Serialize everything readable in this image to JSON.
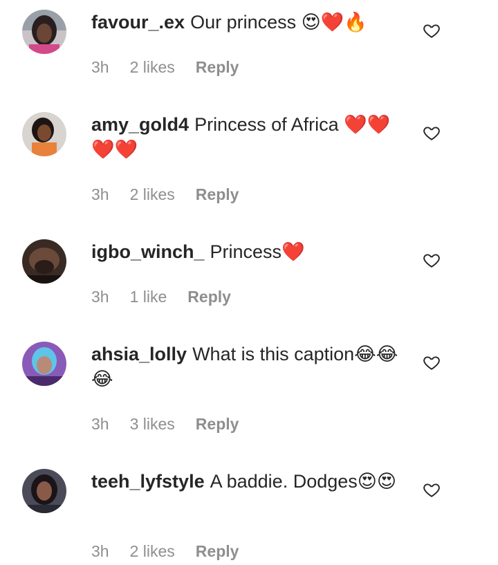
{
  "comments": [
    {
      "username": "favour_.ex",
      "text": "Our princess 😍❤️🔥",
      "time": "3h",
      "likes": "2 likes",
      "reply": "Reply"
    },
    {
      "username": "amy_gold4",
      "text": "Princess of Africa ❤️❤️❤️❤️",
      "time": "3h",
      "likes": "2 likes",
      "reply": "Reply"
    },
    {
      "username": "igbo_winch_",
      "text": "Princess❤️",
      "time": "3h",
      "likes": "1 like",
      "reply": "Reply"
    },
    {
      "username": "ahsia_lolly",
      "text": "What is this caption😂😂😂",
      "time": "3h",
      "likes": "3 likes",
      "reply": "Reply"
    },
    {
      "username": "teeh_lyfstyle",
      "text": "A baddie. Dodges😍😍",
      "time": "3h",
      "likes": "2 likes",
      "reply": "Reply"
    }
  ]
}
